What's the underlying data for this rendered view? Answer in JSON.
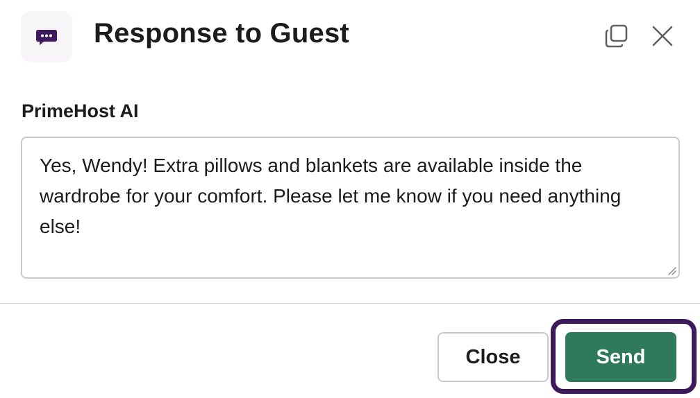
{
  "dialog": {
    "title": "Response to Guest",
    "app_icon": "chat-bubble-icon",
    "header_icons": [
      "popout-icon",
      "close-icon"
    ]
  },
  "form": {
    "label": "PrimeHost AI",
    "message": "Yes, Wendy! Extra pillows and blankets are available inside the wardrobe for your comfort. Please let me know if you need anything else!"
  },
  "footer": {
    "close_label": "Close",
    "send_label": "Send"
  },
  "colors": {
    "accent_purple": "#3d1a5b",
    "send_green": "#2f7a5a"
  }
}
